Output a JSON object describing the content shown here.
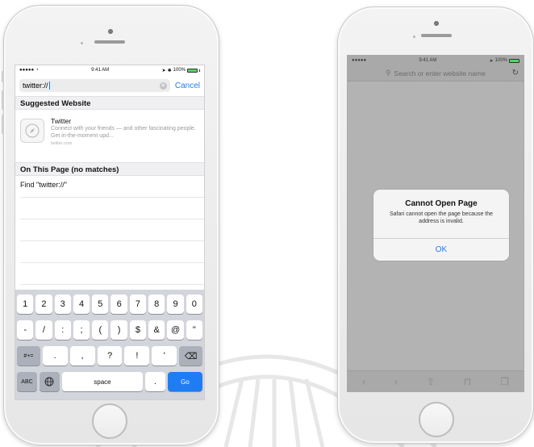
{
  "left_phone": {
    "status": {
      "carrier": "●●●●● ",
      "time": "9:41 AM",
      "battery_pct": "100%"
    },
    "url": {
      "value": "twitter://",
      "cancel_label": "Cancel",
      "clear_icon": "clear-icon"
    },
    "suggested": {
      "heading": "Suggested Website",
      "item_title": "Twitter",
      "item_desc": "Connect with your friends — and other fascinating people. Get in-the-moment upd...",
      "item_url": "twitter.com"
    },
    "on_page": {
      "heading": "On This Page (no matches)",
      "find_text": "Find \"twitter://\""
    },
    "keyboard": {
      "row1": [
        "1",
        "2",
        "3",
        "4",
        "5",
        "6",
        "7",
        "8",
        "9",
        "0"
      ],
      "row2": [
        "-",
        "/",
        ":",
        ";",
        "(",
        ")",
        "$",
        "&",
        "@",
        "\""
      ],
      "row3": [
        "#+=",
        ".",
        ",",
        "?",
        "!",
        "'",
        "⌫"
      ],
      "abc": "ABC",
      "space": "space",
      "dot": ".",
      "go": "Go"
    }
  },
  "right_phone": {
    "status": {
      "carrier": "●●●●● ",
      "time": "9:41 AM",
      "battery_pct": "100%"
    },
    "search_placeholder": "Search or enter website name",
    "alert": {
      "title": "Cannot Open Page",
      "message": "Safari cannot open the page because the address is invalid.",
      "ok_label": "OK"
    }
  },
  "colors": {
    "accent": "#1e7cf5",
    "battery": "#4cd964",
    "dim": "#b3b3b3"
  }
}
